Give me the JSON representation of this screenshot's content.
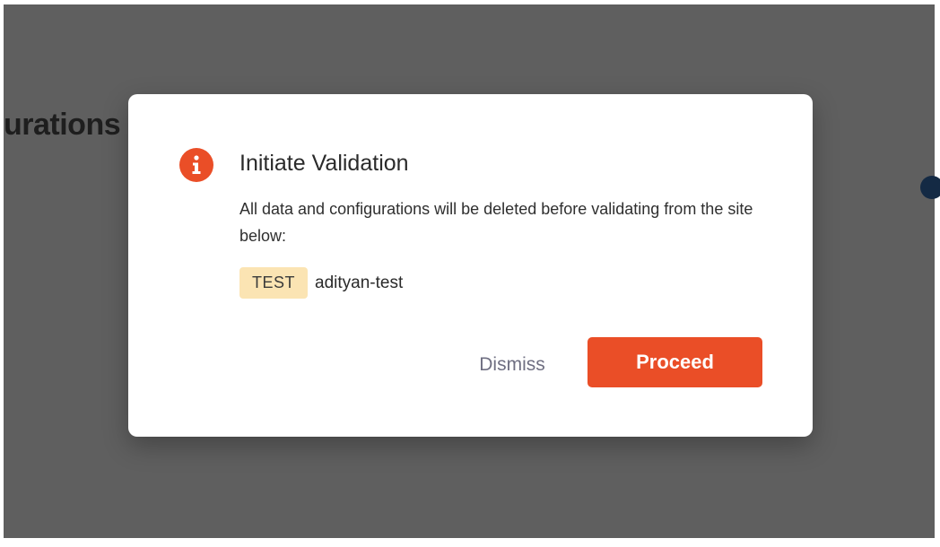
{
  "background": {
    "heading_fragment": "urations"
  },
  "modal": {
    "title": "Initiate Validation",
    "message": "All data and configurations will be deleted before validating from the site below:",
    "icon": "info-icon",
    "site": {
      "environment_badge": "TEST",
      "name": "adityan-test"
    },
    "dismiss_label": "Dismiss",
    "proceed_label": "Proceed"
  },
  "colors": {
    "accent": "#ea4e27",
    "badge_bg": "#fbe4b3",
    "overlay": "#5f5f5f",
    "dismiss_text": "#6f6f82"
  }
}
